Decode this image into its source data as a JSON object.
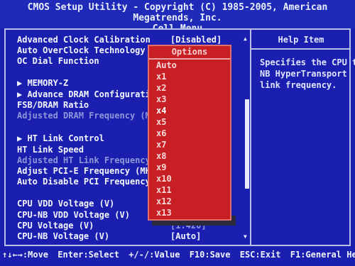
{
  "header": {
    "title": "CMOS Setup Utility - Copyright (C) 1985-2005, American Megatrends, Inc.",
    "subtitle": "Cell Menu"
  },
  "help": {
    "title": "Help Item",
    "lines": [
      "Specifies the CPU to",
      "NB HyperTransport",
      "link frequency."
    ]
  },
  "menu": {
    "items": [
      {
        "label": "Advanced Clock Calibration",
        "value": "[Disabled]"
      },
      {
        "label": "Auto OverClock Technology",
        "value": ""
      },
      {
        "label": "OC Dial Function",
        "value": ""
      },
      {
        "label": "▶ MEMORY-Z",
        "value": ""
      },
      {
        "label": "▶ Advance DRAM Configuration",
        "value": ""
      },
      {
        "label": "FSB/DRAM Ratio",
        "value": ""
      },
      {
        "label": "Adjusted DRAM Frequency (MHz",
        "value": ""
      },
      {
        "label": "▶ HT Link Control",
        "value": ""
      },
      {
        "label": "HT Link Speed",
        "value": ""
      },
      {
        "label": "Adjusted HT Link Frequency (",
        "value": ""
      },
      {
        "label": "Adjust PCI-E Frequency (MHz)",
        "value": ""
      },
      {
        "label": "Auto Disable PCI Frequency",
        "value": ""
      },
      {
        "label": "CPU VDD Voltage (V)",
        "value": ""
      },
      {
        "label": "CPU-NB VDD Voltage (V)",
        "value": ""
      },
      {
        "label": "CPU Voltage (V)",
        "value": "[1.420]"
      },
      {
        "label": "CPU-NB Voltage (V)",
        "value": "[Auto]"
      }
    ]
  },
  "popup": {
    "title": "Options",
    "options": [
      "Auto",
      "x1",
      "x2",
      "x3",
      "x4",
      "x5",
      "x6",
      "x7",
      "x8",
      "x9",
      "x10",
      "x11",
      "x12",
      "x13"
    ],
    "selected": "x4"
  },
  "status_bar": {
    "move": "↑↓←→:Move",
    "select": "Enter:Select",
    "value": "+/-/:Value",
    "save": "F10:Save",
    "exit": "ESC:Exit",
    "help": "F1:General Help"
  },
  "colors": {
    "background": "#1a1fb0",
    "popup": "#c71f24",
    "text": "#ffffff",
    "dim_text": "#8f97d8"
  }
}
